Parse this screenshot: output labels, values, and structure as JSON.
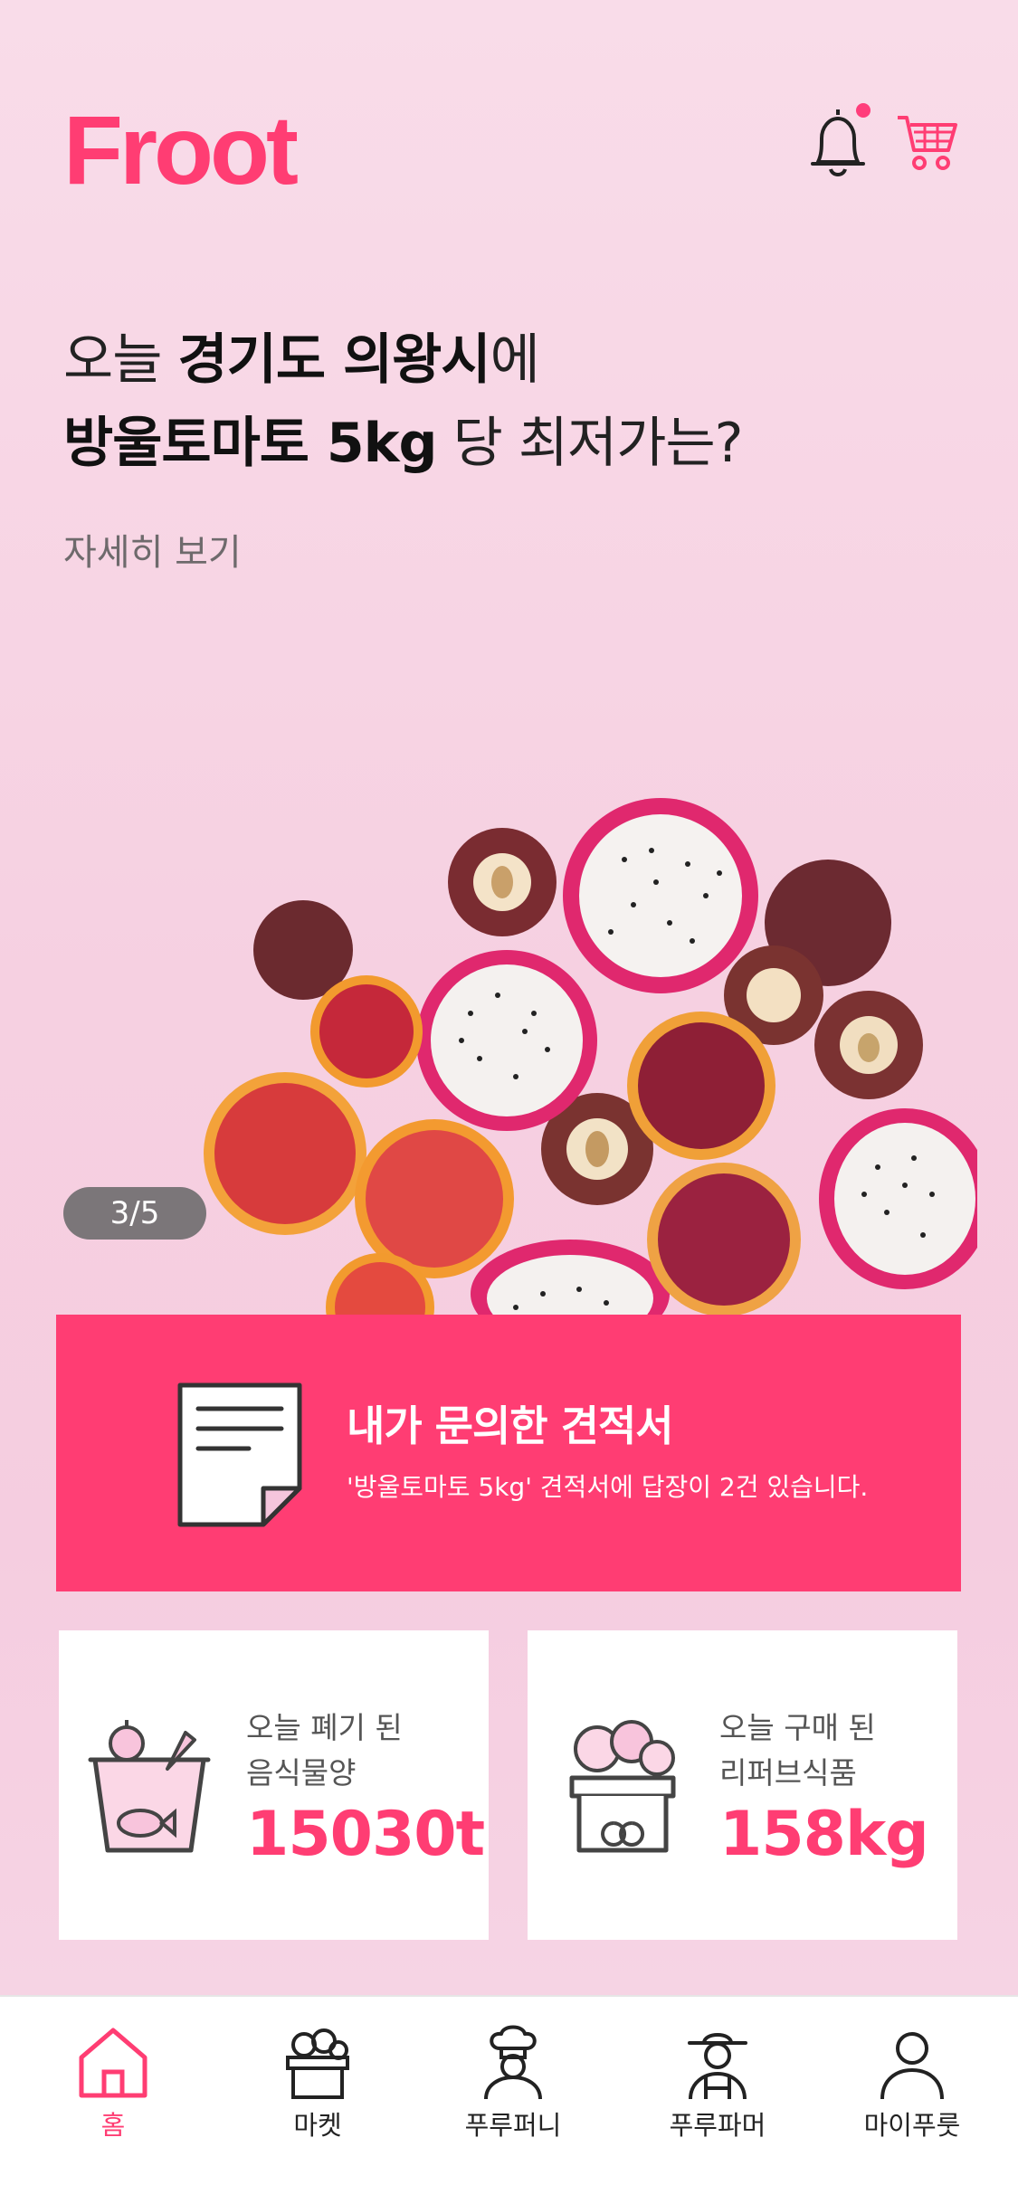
{
  "header": {
    "logo_text": "Froot",
    "notification_dot_color": "#ff3d7b"
  },
  "hero": {
    "line1_prefix": "오늘 ",
    "line1_bold": "경기도 의왕시",
    "line1_suffix": "에",
    "line2_bold": "방울토마토 5kg",
    "line2_suffix": " 당 최저가는?",
    "more_link": "자세히 보기",
    "pager": "3/5"
  },
  "quote_banner": {
    "title": "내가 문의한 견적서",
    "subtitle": "'방울토마토 5kg' 견적서에 답장이 2건 있습니다."
  },
  "stats": {
    "waste": {
      "label_line1": "오늘 폐기 된",
      "label_line2": "음식물양",
      "value": "15030t"
    },
    "refurb": {
      "label_line1": "오늘 구매 된",
      "label_line2": "리퍼브식품",
      "value": "158kg"
    }
  },
  "nav": {
    "items": [
      {
        "label": "홈",
        "icon": "home-icon",
        "active": true
      },
      {
        "label": "마켓",
        "icon": "market-basket-icon",
        "active": false
      },
      {
        "label": "푸루퍼니",
        "icon": "chef-icon",
        "active": false
      },
      {
        "label": "푸루파머",
        "icon": "farmer-icon",
        "active": false
      },
      {
        "label": "마이푸룻",
        "icon": "user-icon",
        "active": false
      }
    ]
  },
  "colors": {
    "accent": "#ff3d73",
    "background": "#f7d6e5"
  }
}
